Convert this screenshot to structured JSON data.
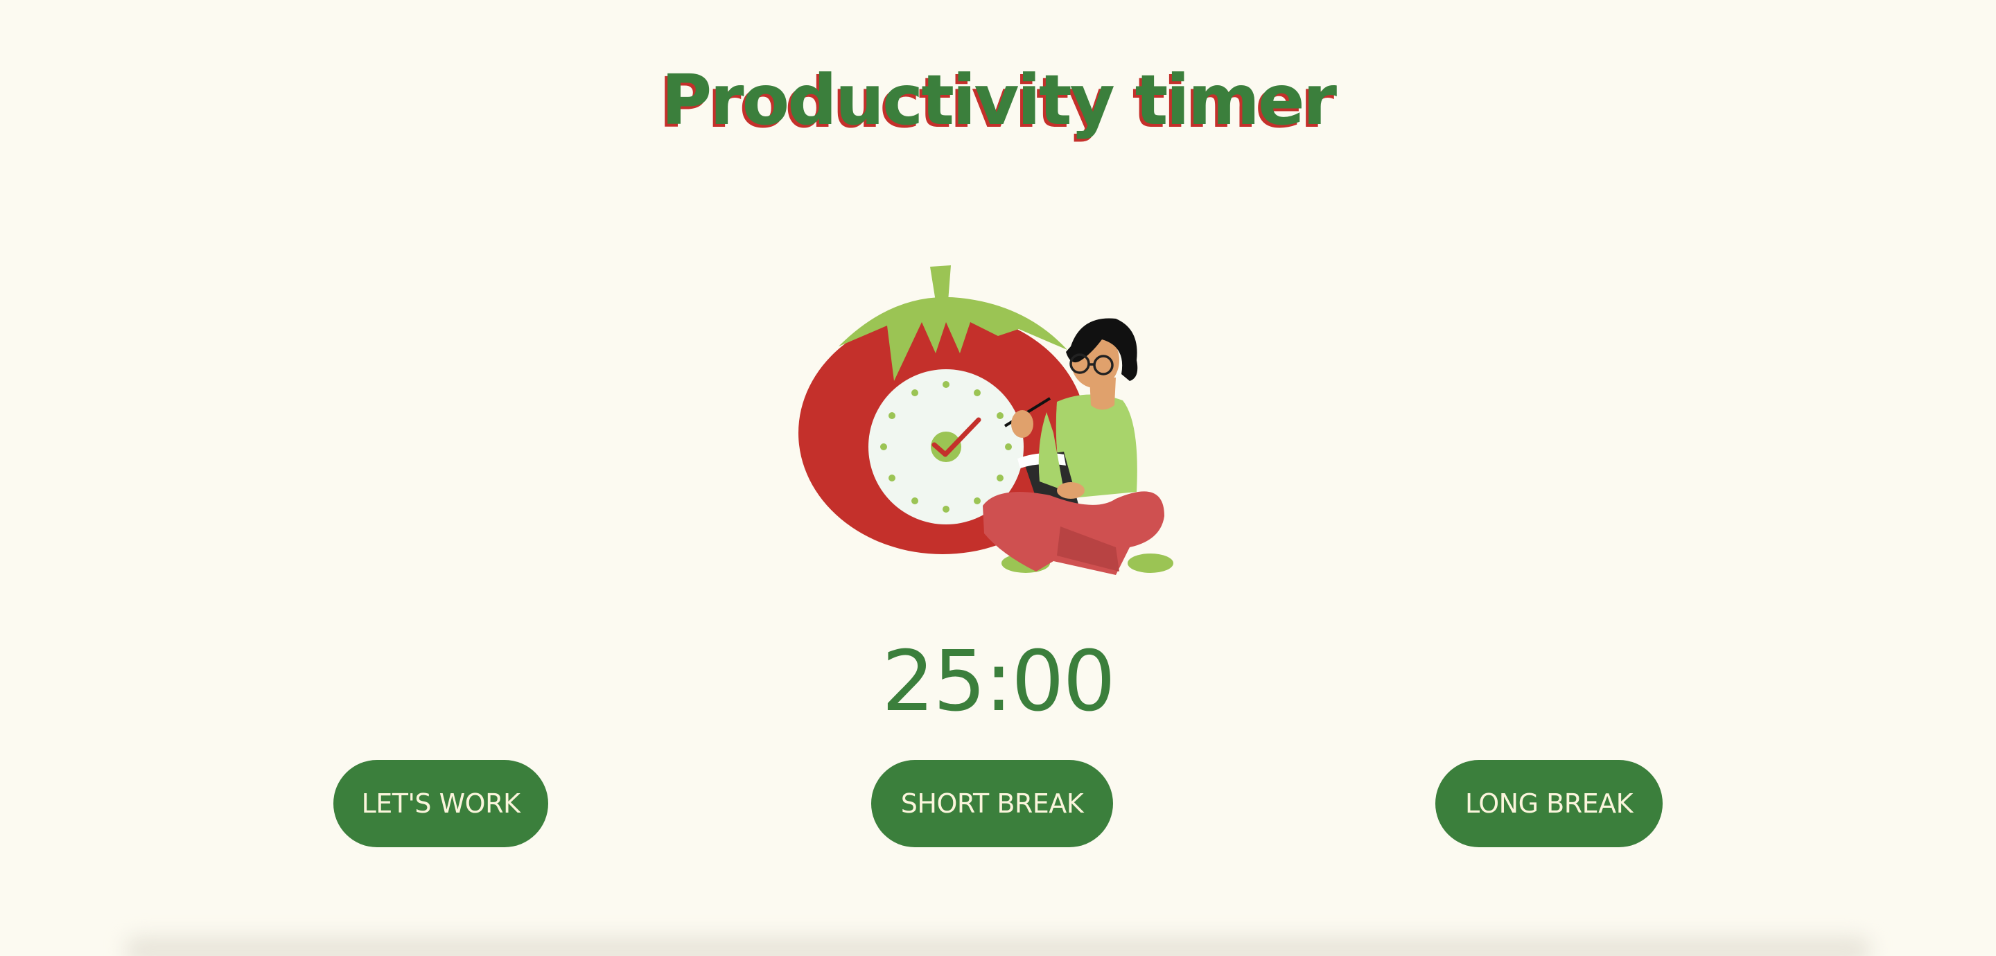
{
  "header": {
    "title": "Productivity timer"
  },
  "illustration": {
    "name": "tomato-clock-person-illustration"
  },
  "timer": {
    "display": "25:00"
  },
  "modes": {
    "work_label": "LET'S WORK",
    "short_break_label": "SHORT BREAK",
    "long_break_label": "LONG BREAK"
  },
  "colors": {
    "background": "#fcfaf1",
    "primary_green": "#3b7f3c",
    "tomato_red": "#c4302b",
    "leaf_green": "#9bc454",
    "button_text": "#fbf5dc"
  }
}
